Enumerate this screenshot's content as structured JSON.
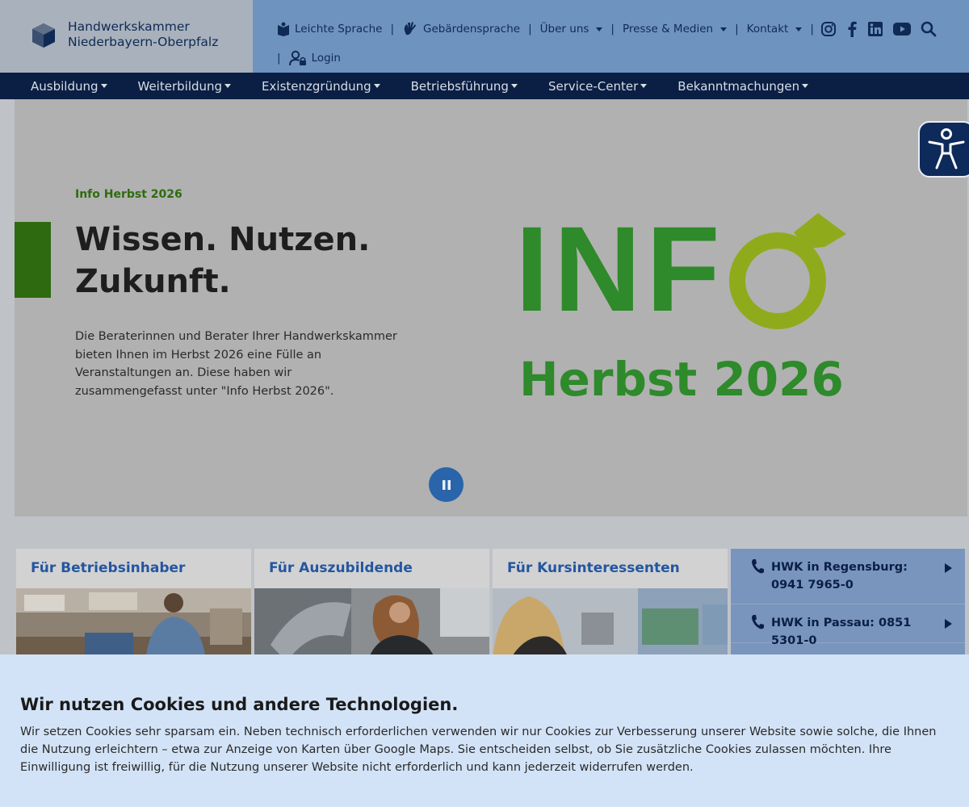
{
  "header": {
    "logo_line1": "Handwerkskammer",
    "logo_line2": "Niederbayern-Oberpfalz",
    "meta_links": {
      "easy_language": "Leichte Sprache",
      "sign_language": "Gebärdensprache",
      "about": "Über uns",
      "press": "Presse & Medien",
      "contact": "Kontakt",
      "login": "Login"
    },
    "separator": "|",
    "social_icons": [
      "instagram-icon",
      "facebook-icon",
      "linkedin-icon",
      "youtube-icon",
      "search-icon"
    ]
  },
  "nav": {
    "items": [
      "Ausbildung",
      "Weiterbildung",
      "Existenzgründung",
      "Betriebsführung",
      "Service-Center",
      "Bekanntmachungen"
    ]
  },
  "hero": {
    "kicker": "Info Herbst 2026",
    "title_line1": "Wissen. Nutzen.",
    "title_line2": "Zukunft.",
    "text": "Die Beraterinnen und Berater Ihrer Handwerkskammer bieten Ihnen im Herbst 2026 eine Fülle an Veranstaltungen an. Diese haben wir zusammengefasst unter \"Info Herbst 2026\".",
    "graphic_word": "INF",
    "graphic_sub": "Herbst 2026",
    "colors": {
      "green_dark": "#2e8a2a",
      "green_light": "#8fab1c",
      "accent": "#2e6a10"
    }
  },
  "cards": [
    {
      "title": "Für Betriebsinhaber"
    },
    {
      "title": "Für Auszubildende"
    },
    {
      "title": "Für Kursinteressenten"
    }
  ],
  "contacts": [
    {
      "label": "HWK in Regensburg: 0941 7965-0"
    },
    {
      "label": "HWK in Passau: 0851 5301-0"
    }
  ],
  "cookie": {
    "title": "Wir nutzen Cookies und andere Technologien.",
    "text": "Wir setzen Cookies sehr sparsam ein. Neben technisch erforderlichen verwenden wir nur Cookies zur Verbesserung unserer Website sowie solche, die Ihnen die Nutzung erleichtern – etwa zur Anzeige von Karten über Google Maps. Sie entscheiden selbst, ob Sie zusätzliche Cookies zulassen möchten. Ihre Einwilligung ist freiwillig, für die Nutzung unserer Website nicht erforderlich und kann jederzeit widerrufen werden."
  }
}
